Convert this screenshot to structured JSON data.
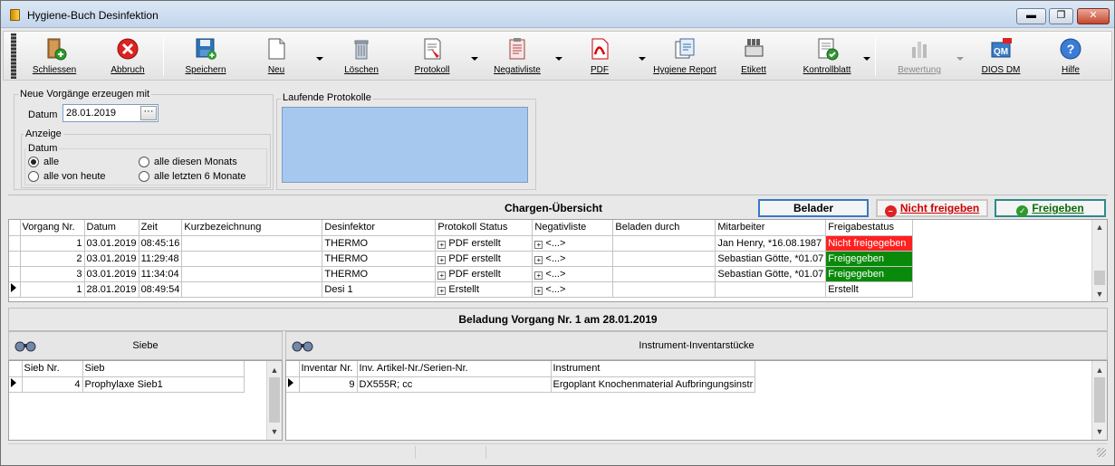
{
  "window": {
    "title": "Hygiene-Buch Desinfektion",
    "min": "▬",
    "max": "❐",
    "close": "✕"
  },
  "toolbar": {
    "schliessen": "Schliessen",
    "abbruch": "Abbruch",
    "speichern": "Speichern",
    "neu": "Neu",
    "loeschen": "Löschen",
    "protokoll": "Protokoll",
    "negativliste": "Negativliste",
    "pdf": "PDF",
    "hygiene_report": "Hygiene Report",
    "etikett": "Etikett",
    "kontrollblatt": "Kontrollblatt",
    "bewertung": "Bewertung",
    "dios_dm": "DIOS DM",
    "hilfe": "Hilfe"
  },
  "neue_vorgaenge": {
    "title": "Neue Vorgänge erzeugen mit",
    "datum_label": "Datum",
    "datum_value": "28.01.2019",
    "picker": "···"
  },
  "anzeige": {
    "title": "Anzeige",
    "datum_group": "Datum",
    "options": [
      "alle",
      "alle von heute",
      "alle diesen Monats",
      "alle letzten 6 Monate"
    ],
    "selected": "alle"
  },
  "laufende_protokolle": {
    "title": "Laufende Protokolle"
  },
  "chargen": {
    "title": "Chargen-Übersicht",
    "btn_belader": "Belader",
    "btn_nicht_freigeben": "Nicht freigeben",
    "btn_freigeben": "Freigeben",
    "columns": [
      "Vorgang Nr.",
      "Datum",
      "Zeit",
      "Kurzbezeichnung",
      "Desinfektor",
      "Protokoll Status",
      "Negativliste",
      "Beladen durch",
      "Mitarbeiter",
      "Freigabestatus"
    ],
    "rows": [
      [
        "1",
        "03.01.2019",
        "08:45:16",
        "",
        "THERMO",
        "PDF erstellt",
        "<...>",
        "",
        "Jan Henry, *16.08.1987",
        "Nicht freigegeben"
      ],
      [
        "2",
        "03.01.2019",
        "11:29:48",
        "",
        "THERMO",
        "PDF erstellt",
        "<...>",
        "",
        "Sebastian Götte, *01.07",
        "Freigegeben"
      ],
      [
        "3",
        "03.01.2019",
        "11:34:04",
        "",
        "THERMO",
        "PDF erstellt",
        "<...>",
        "",
        "Sebastian Götte, *01.07",
        "Freigegeben"
      ],
      [
        "1",
        "28.01.2019",
        "08:49:54",
        "",
        "Desi 1",
        "Erstellt",
        "<...>",
        "",
        "",
        "Erstellt"
      ]
    ],
    "status_colors": {
      "Nicht freigegeben": "#ff2020",
      "Freigegeben": "#0a8a0a",
      "Erstellt": "#ffffff"
    }
  },
  "beladung": {
    "title": "Beladung Vorgang Nr. 1 am 28.01.2019",
    "siebe": {
      "title": "Siebe",
      "columns": [
        "Sieb Nr.",
        "Sieb"
      ],
      "rows": [
        [
          "4",
          "Prophylaxe Sieb1"
        ]
      ]
    },
    "instrumente": {
      "title": "Instrument-Inventarstücke",
      "columns": [
        "Inventar Nr.",
        "Inv. Artikel-Nr./Serien-Nr.",
        "Instrument"
      ],
      "rows": [
        [
          "9",
          "DX555R; cc",
          "Ergoplant Knochenmaterial Aufbringungsinstr"
        ]
      ]
    }
  },
  "colors": {
    "accent_blue": "#3578c6",
    "protocol_box": "#a7c8ee",
    "red": "#ff2020",
    "green": "#0a8a0a"
  }
}
